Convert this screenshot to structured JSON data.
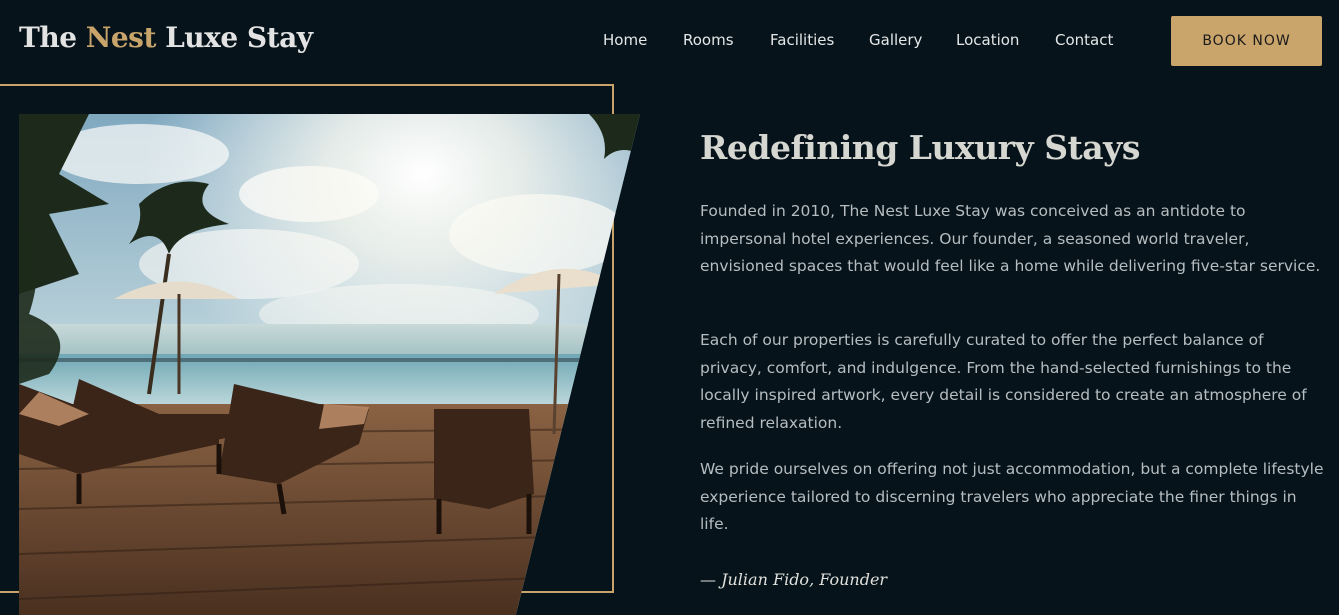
{
  "header": {
    "logo_part1": "The ",
    "logo_accent": "Nest",
    "logo_part2": " Luxe Stay",
    "nav": [
      "Home",
      "Rooms",
      "Facilities",
      "Gallery",
      "Location",
      "Contact"
    ],
    "cta": "BOOK NOW"
  },
  "about": {
    "heading": "Redefining Luxury Stays",
    "paragraphs": [
      "Founded in 2010, The Nest Luxe Stay was conceived as an antidote to impersonal hotel experiences. Our founder, a seasoned world traveler, envisioned spaces that would feel like a home while delivering five-star service.",
      "Each of our properties is carefully curated to offer the perfect balance of privacy, comfort, and indulgence. From the hand-selected furnishings to the locally inspired artwork, every detail is considered to create an atmosphere of refined relaxation.",
      "We pride ourselves on offering not just accommodation, but a complete lifestyle experience tailored to discerning travelers who appreciate the finer things in life."
    ],
    "signature": "— Julian Fido, Founder"
  },
  "colors": {
    "background": "#06131a",
    "accent": "#c8a46b",
    "text": "#b6bdc1"
  }
}
